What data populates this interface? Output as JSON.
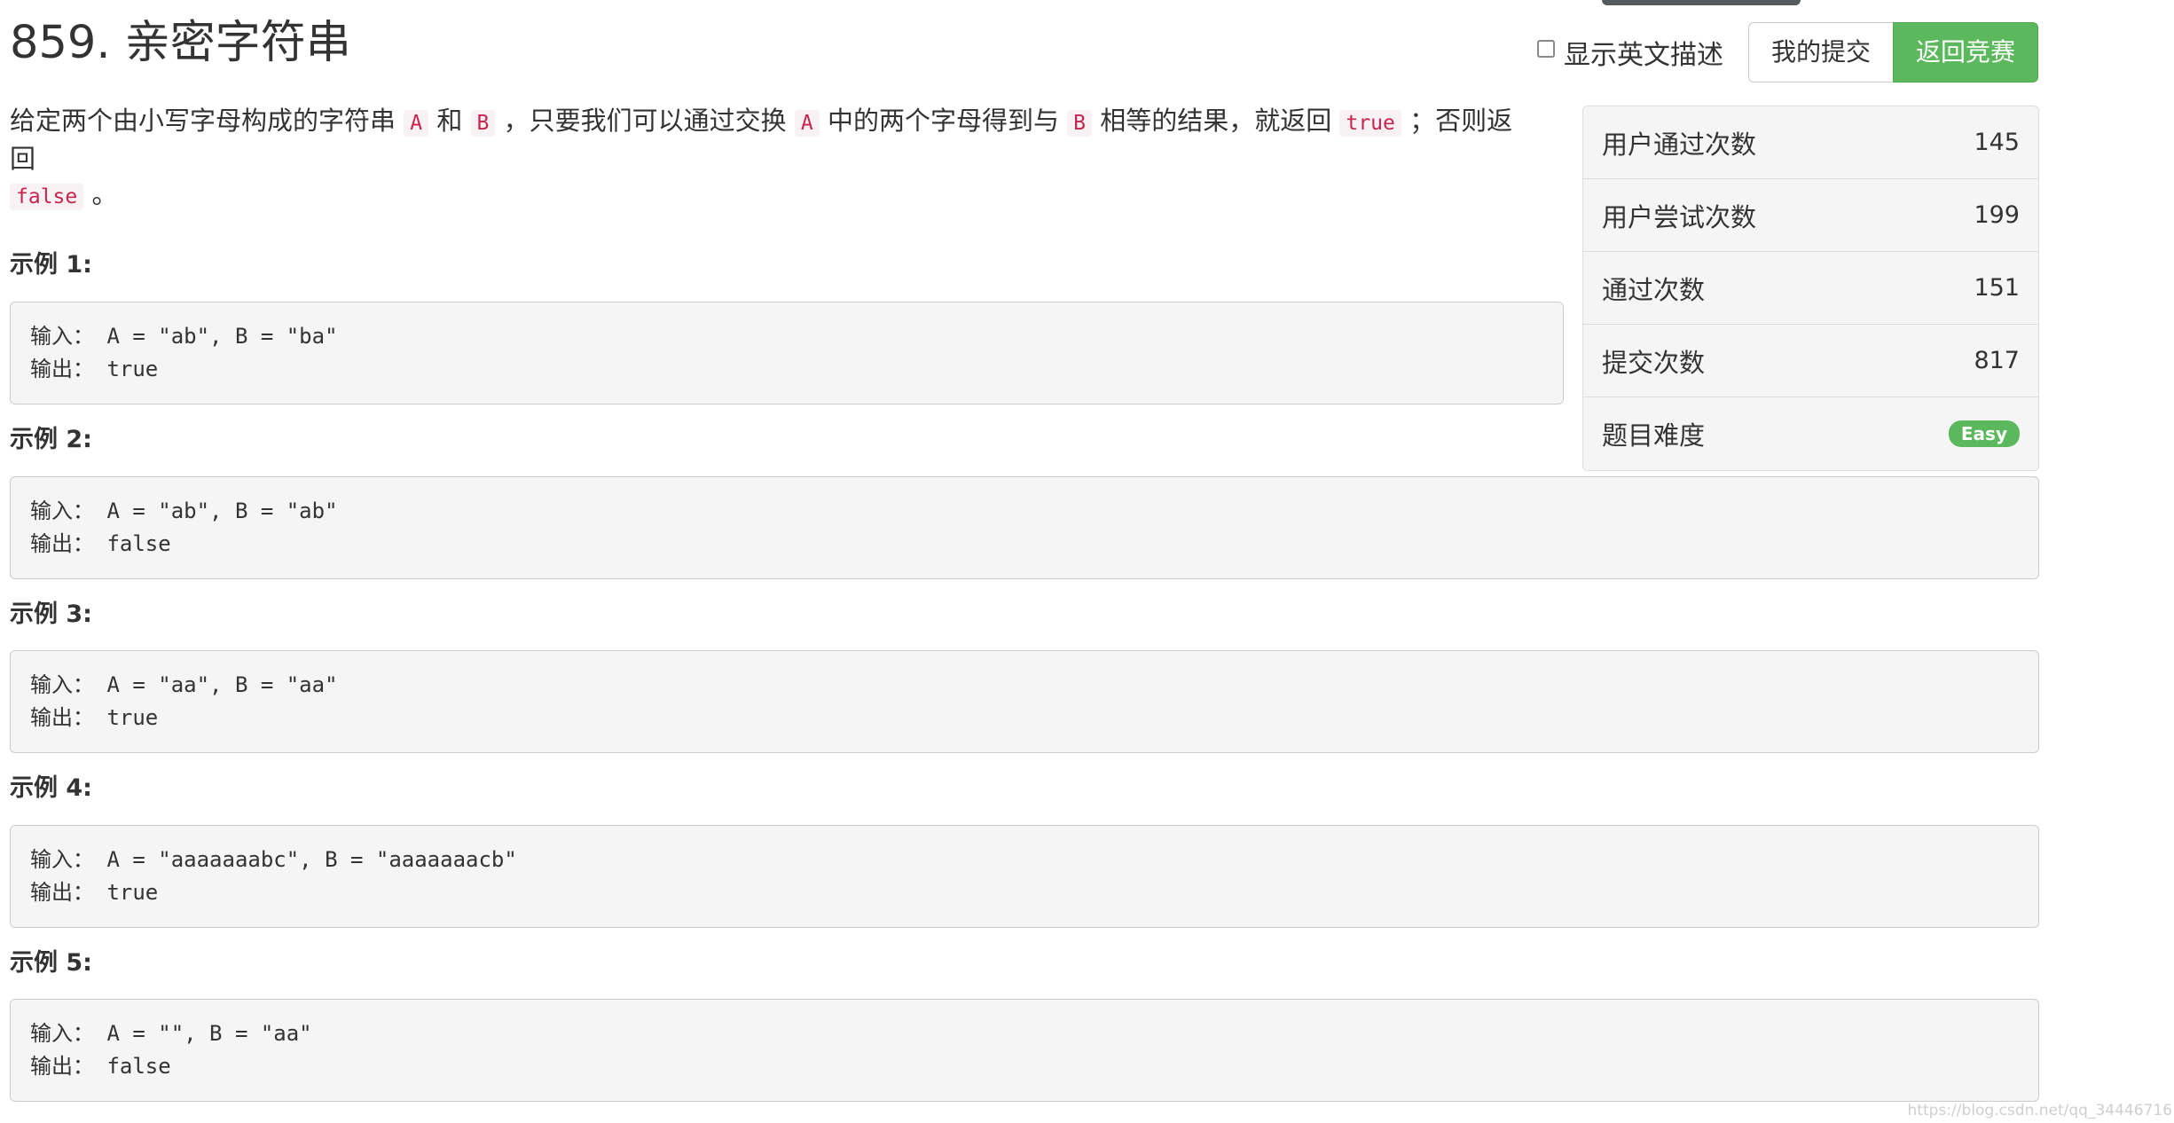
{
  "problem": {
    "title": "859. 亲密字符串"
  },
  "toolbar": {
    "show_english_label": "显示英文描述",
    "my_submissions_label": "我的提交",
    "back_to_contest_label": "返回竞赛"
  },
  "description": {
    "seg1": "给定两个由小写字母构成的字符串",
    "code_a": "A",
    "seg2": "和",
    "code_b": "B",
    "seg3": "，只要我们可以通过交换",
    "code_a2": "A",
    "seg4": "中的两个字母得到与",
    "code_b2": "B",
    "seg5": "相等的结果，就返回",
    "code_true": "true",
    "seg6": "；否则返回",
    "code_false": "false",
    "seg7": "。"
  },
  "examples": [
    {
      "heading": "示例 1:",
      "input": "输入： A = \"ab\", B = \"ba\"",
      "output": "输出： true"
    },
    {
      "heading": "示例 2:",
      "input": "输入： A = \"ab\", B = \"ab\"",
      "output": "输出： false"
    },
    {
      "heading": "示例 3:",
      "input": "输入： A = \"aa\", B = \"aa\"",
      "output": "输出： true"
    },
    {
      "heading": "示例 4:",
      "input": "输入： A = \"aaaaaaabc\", B = \"aaaaaaacb\"",
      "output": "输出： true"
    },
    {
      "heading": "示例 5:",
      "input": "输入： A = \"\", B = \"aa\"",
      "output": "输出： false"
    }
  ],
  "stats": {
    "users_passed_label": "用户通过次数",
    "users_passed_value": "145",
    "users_tried_label": "用户尝试次数",
    "users_tried_value": "199",
    "passed_label": "通过次数",
    "passed_value": "151",
    "submissions_label": "提交次数",
    "submissions_value": "817",
    "difficulty_label": "题目难度",
    "difficulty_value": "Easy"
  },
  "watermark": "https://blog.csdn.net/qq_34446716",
  "colors": {
    "success": "#5cb85c",
    "code_text": "#c7254e",
    "code_bg": "#f9f2f4",
    "example_bg": "#f5f5f5"
  }
}
